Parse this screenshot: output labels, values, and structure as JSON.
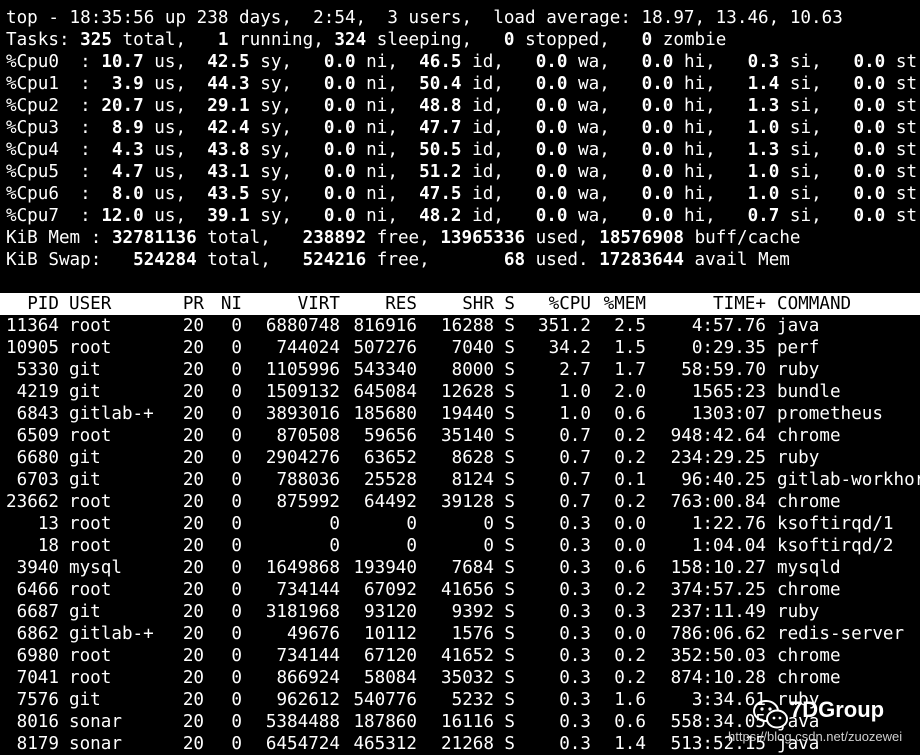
{
  "summary": {
    "line1": "top - 18:35:56 up 238 days,  2:54,  3 users,  load average: 18.97, 13.46, 10.63",
    "tasks": {
      "prefix": "Tasks: ",
      "total": "325",
      "t1": " total,   ",
      "running": "1",
      "t2": " running, ",
      "sleeping": "324",
      "t3": " sleeping,   ",
      "stopped": "0",
      "t4": " stopped,   ",
      "zombie": "0",
      "t5": " zombie"
    },
    "cpus": [
      {
        "label": "%Cpu0  : ",
        "us": "10.7",
        "sy": "42.5",
        "ni": "0.0",
        "id": "46.5",
        "wa": "0.0",
        "hi": "0.0",
        "si": "0.3",
        "st": "0.0"
      },
      {
        "label": "%Cpu1  : ",
        "us": " 3.9",
        "sy": "44.3",
        "ni": "0.0",
        "id": "50.4",
        "wa": "0.0",
        "hi": "0.0",
        "si": "1.4",
        "st": "0.0"
      },
      {
        "label": "%Cpu2  : ",
        "us": "20.7",
        "sy": "29.1",
        "ni": "0.0",
        "id": "48.8",
        "wa": "0.0",
        "hi": "0.0",
        "si": "1.3",
        "st": "0.0"
      },
      {
        "label": "%Cpu3  : ",
        "us": " 8.9",
        "sy": "42.4",
        "ni": "0.0",
        "id": "47.7",
        "wa": "0.0",
        "hi": "0.0",
        "si": "1.0",
        "st": "0.0"
      },
      {
        "label": "%Cpu4  : ",
        "us": " 4.3",
        "sy": "43.8",
        "ni": "0.0",
        "id": "50.5",
        "wa": "0.0",
        "hi": "0.0",
        "si": "1.3",
        "st": "0.0"
      },
      {
        "label": "%Cpu5  : ",
        "us": " 4.7",
        "sy": "43.1",
        "ni": "0.0",
        "id": "51.2",
        "wa": "0.0",
        "hi": "0.0",
        "si": "1.0",
        "st": "0.0"
      },
      {
        "label": "%Cpu6  : ",
        "us": " 8.0",
        "sy": "43.5",
        "ni": "0.0",
        "id": "47.5",
        "wa": "0.0",
        "hi": "0.0",
        "si": "1.0",
        "st": "0.0"
      },
      {
        "label": "%Cpu7  : ",
        "us": "12.0",
        "sy": "39.1",
        "ni": "0.0",
        "id": "48.2",
        "wa": "0.0",
        "hi": "0.0",
        "si": "0.7",
        "st": "0.0"
      }
    ],
    "mem": {
      "label": "KiB Mem : ",
      "total": "32781136",
      "t1": " total,   ",
      "free": "238892",
      "t2": " free, ",
      "used": "13965336",
      "t3": " used, ",
      "cache": "18576908",
      "t4": " buff/cache"
    },
    "swap": {
      "label": "KiB Swap:   ",
      "total": "524284",
      "t1": " total,   ",
      "free": "524216",
      "t2": " free,       ",
      "used": "68",
      "t3": " used. ",
      "avail": "17283644",
      "t4": " avail Mem"
    }
  },
  "columns": {
    "pid": "PID",
    "user": "USER",
    "pr": "PR",
    "ni": "NI",
    "virt": "VIRT",
    "res": "RES",
    "shr": "SHR",
    "s": "S",
    "cpu": "%CPU",
    "mem": "%MEM",
    "time": "TIME+",
    "cmd": "COMMAND"
  },
  "processes": [
    {
      "pid": "11364",
      "user": "root",
      "pr": "20",
      "ni": "0",
      "virt": "6880748",
      "res": "816916",
      "shr": "16288",
      "s": "S",
      "cpu": "351.2",
      "mem": "2.5",
      "time": "4:57.76",
      "cmd": "java"
    },
    {
      "pid": "10905",
      "user": "root",
      "pr": "20",
      "ni": "0",
      "virt": "744024",
      "res": "507276",
      "shr": "7040",
      "s": "S",
      "cpu": "34.2",
      "mem": "1.5",
      "time": "0:29.35",
      "cmd": "perf"
    },
    {
      "pid": "5330",
      "user": "git",
      "pr": "20",
      "ni": "0",
      "virt": "1105996",
      "res": "543340",
      "shr": "8000",
      "s": "S",
      "cpu": "2.7",
      "mem": "1.7",
      "time": "58:59.70",
      "cmd": "ruby"
    },
    {
      "pid": "4219",
      "user": "git",
      "pr": "20",
      "ni": "0",
      "virt": "1509132",
      "res": "645084",
      "shr": "12628",
      "s": "S",
      "cpu": "1.0",
      "mem": "2.0",
      "time": "1565:23",
      "cmd": "bundle"
    },
    {
      "pid": "6843",
      "user": "gitlab-+",
      "pr": "20",
      "ni": "0",
      "virt": "3893016",
      "res": "185680",
      "shr": "19440",
      "s": "S",
      "cpu": "1.0",
      "mem": "0.6",
      "time": "1303:07",
      "cmd": "prometheus"
    },
    {
      "pid": "6509",
      "user": "root",
      "pr": "20",
      "ni": "0",
      "virt": "870508",
      "res": "59656",
      "shr": "35140",
      "s": "S",
      "cpu": "0.7",
      "mem": "0.2",
      "time": "948:42.64",
      "cmd": "chrome"
    },
    {
      "pid": "6680",
      "user": "git",
      "pr": "20",
      "ni": "0",
      "virt": "2904276",
      "res": "63652",
      "shr": "8628",
      "s": "S",
      "cpu": "0.7",
      "mem": "0.2",
      "time": "234:29.25",
      "cmd": "ruby"
    },
    {
      "pid": "6703",
      "user": "git",
      "pr": "20",
      "ni": "0",
      "virt": "788036",
      "res": "25528",
      "shr": "8124",
      "s": "S",
      "cpu": "0.7",
      "mem": "0.1",
      "time": "96:40.25",
      "cmd": "gitlab-workhors"
    },
    {
      "pid": "23662",
      "user": "root",
      "pr": "20",
      "ni": "0",
      "virt": "875992",
      "res": "64492",
      "shr": "39128",
      "s": "S",
      "cpu": "0.7",
      "mem": "0.2",
      "time": "763:00.84",
      "cmd": "chrome"
    },
    {
      "pid": "13",
      "user": "root",
      "pr": "20",
      "ni": "0",
      "virt": "0",
      "res": "0",
      "shr": "0",
      "s": "S",
      "cpu": "0.3",
      "mem": "0.0",
      "time": "1:22.76",
      "cmd": "ksoftirqd/1"
    },
    {
      "pid": "18",
      "user": "root",
      "pr": "20",
      "ni": "0",
      "virt": "0",
      "res": "0",
      "shr": "0",
      "s": "S",
      "cpu": "0.3",
      "mem": "0.0",
      "time": "1:04.04",
      "cmd": "ksoftirqd/2"
    },
    {
      "pid": "3940",
      "user": "mysql",
      "pr": "20",
      "ni": "0",
      "virt": "1649868",
      "res": "193940",
      "shr": "7684",
      "s": "S",
      "cpu": "0.3",
      "mem": "0.6",
      "time": "158:10.27",
      "cmd": "mysqld"
    },
    {
      "pid": "6466",
      "user": "root",
      "pr": "20",
      "ni": "0",
      "virt": "734144",
      "res": "67092",
      "shr": "41656",
      "s": "S",
      "cpu": "0.3",
      "mem": "0.2",
      "time": "374:57.25",
      "cmd": "chrome"
    },
    {
      "pid": "6687",
      "user": "git",
      "pr": "20",
      "ni": "0",
      "virt": "3181968",
      "res": "93120",
      "shr": "9392",
      "s": "S",
      "cpu": "0.3",
      "mem": "0.3",
      "time": "237:11.49",
      "cmd": "ruby"
    },
    {
      "pid": "6862",
      "user": "gitlab-+",
      "pr": "20",
      "ni": "0",
      "virt": "49676",
      "res": "10112",
      "shr": "1576",
      "s": "S",
      "cpu": "0.3",
      "mem": "0.0",
      "time": "786:06.62",
      "cmd": "redis-server"
    },
    {
      "pid": "6980",
      "user": "root",
      "pr": "20",
      "ni": "0",
      "virt": "734144",
      "res": "67120",
      "shr": "41652",
      "s": "S",
      "cpu": "0.3",
      "mem": "0.2",
      "time": "352:50.03",
      "cmd": "chrome"
    },
    {
      "pid": "7041",
      "user": "root",
      "pr": "20",
      "ni": "0",
      "virt": "866924",
      "res": "58084",
      "shr": "35032",
      "s": "S",
      "cpu": "0.3",
      "mem": "0.2",
      "time": "874:10.28",
      "cmd": "chrome"
    },
    {
      "pid": "7576",
      "user": "git",
      "pr": "20",
      "ni": "0",
      "virt": "962612",
      "res": "540776",
      "shr": "5232",
      "s": "S",
      "cpu": "0.3",
      "mem": "1.6",
      "time": "3:34.61",
      "cmd": "ruby"
    },
    {
      "pid": "8016",
      "user": "sonar",
      "pr": "20",
      "ni": "0",
      "virt": "5384488",
      "res": "187860",
      "shr": "16116",
      "s": "S",
      "cpu": "0.3",
      "mem": "0.6",
      "time": "558:34.05",
      "cmd": "java"
    },
    {
      "pid": "8179",
      "user": "sonar",
      "pr": "20",
      "ni": "0",
      "virt": "6454724",
      "res": "465312",
      "shr": "21268",
      "s": "S",
      "cpu": "0.3",
      "mem": "1.4",
      "time": "513:52.15",
      "cmd": "java"
    }
  ],
  "watermark": {
    "brand": "7DGroup",
    "url": "https://blog.csdn.net/zuozewei",
    "icon": "wechat-icon"
  }
}
